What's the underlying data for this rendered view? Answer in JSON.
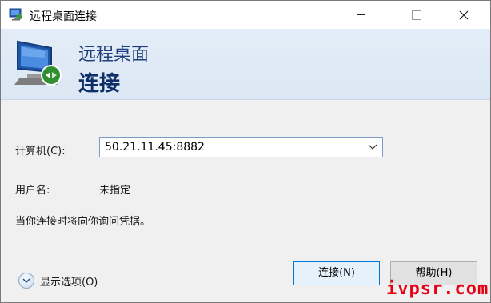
{
  "window": {
    "title": "远程桌面连接",
    "controls": {
      "minimize": "minimize-icon",
      "maximize": "maximize-icon",
      "close": "close-icon"
    }
  },
  "banner": {
    "subtitle": "远程桌面",
    "title": "连接",
    "icon": "remote-desktop-icon"
  },
  "form": {
    "computer_label": "计算机(C):",
    "computer_value": "50.21.11.45:8882",
    "username_label": "用户名:",
    "username_value": "未指定",
    "info_text": "当你连接时将向你询问凭据。"
  },
  "footer": {
    "options_label": "显示选项(O)",
    "connect_label": "连接(N)",
    "help_label": "帮助(H)"
  },
  "watermark": "ivpsr.com",
  "colors": {
    "accent": "#0078d7",
    "banner": "#dbe7f4",
    "title_text": "#0f2f6a",
    "watermark": "#e60012"
  }
}
